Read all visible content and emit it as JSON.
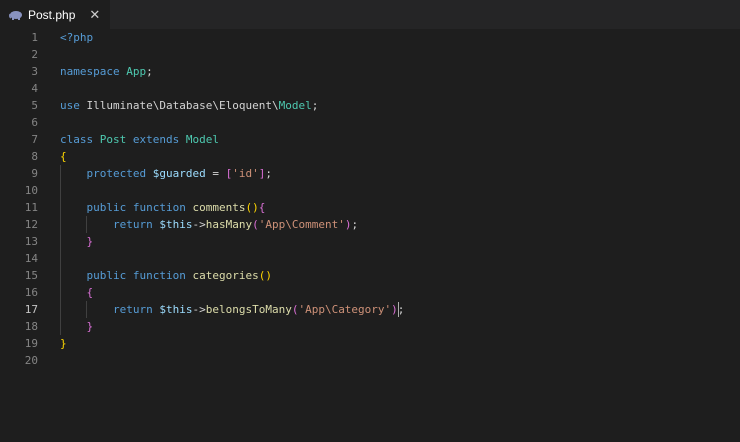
{
  "tab": {
    "title": "Post.php",
    "icon": "php-elephant-icon",
    "close": "✕"
  },
  "colors": {
    "keyword": "#569cd6",
    "class_name": "#4ec9b0",
    "function": "#dcdcaa",
    "string": "#ce9178",
    "variable": "#9cdcfe",
    "bracket_gold": "#ffd700",
    "bracket_purple": "#da70d6",
    "plain": "#d4d4d4"
  },
  "editor": {
    "active_line": 17,
    "lines": [
      {
        "num": "1",
        "code": "<?php"
      },
      {
        "num": "2",
        "code": ""
      },
      {
        "num": "3",
        "code": "namespace App;"
      },
      {
        "num": "4",
        "code": ""
      },
      {
        "num": "5",
        "code": "use Illuminate\\Database\\Eloquent\\Model;"
      },
      {
        "num": "6",
        "code": ""
      },
      {
        "num": "7",
        "code": "class Post extends Model"
      },
      {
        "num": "8",
        "code": "{"
      },
      {
        "num": "9",
        "code": "    protected $guarded = ['id'];"
      },
      {
        "num": "10",
        "code": ""
      },
      {
        "num": "11",
        "code": "    public function comments(){"
      },
      {
        "num": "12",
        "code": "        return $this->hasMany('App\\Comment');"
      },
      {
        "num": "13",
        "code": "    }"
      },
      {
        "num": "14",
        "code": ""
      },
      {
        "num": "15",
        "code": "    public function categories()"
      },
      {
        "num": "16",
        "code": "    {"
      },
      {
        "num": "17",
        "code": "        return $this->belongsToMany('App\\Category');"
      },
      {
        "num": "18",
        "code": "    }"
      },
      {
        "num": "19",
        "code": "}"
      },
      {
        "num": "20",
        "code": ""
      }
    ]
  }
}
